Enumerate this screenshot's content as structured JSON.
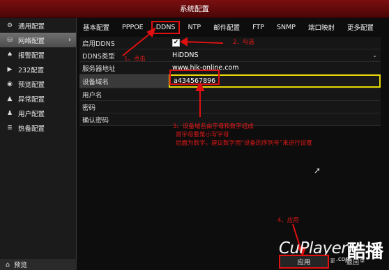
{
  "window": {
    "title": "系统配置"
  },
  "sidebar": {
    "items": [
      {
        "label": "通用配置",
        "icon": "gear-icon",
        "glyph": "⚙"
      },
      {
        "label": "网络配置",
        "icon": "network-icon",
        "glyph": "⛁",
        "active": true
      },
      {
        "label": "报警配置",
        "icon": "bell-icon",
        "glyph": "♠"
      },
      {
        "label": "232配置",
        "icon": "port-icon",
        "glyph": "▶"
      },
      {
        "label": "预览配置",
        "icon": "eye-icon",
        "glyph": "◉"
      },
      {
        "label": "异常配置",
        "icon": "warning-icon",
        "glyph": "▲"
      },
      {
        "label": "用户配置",
        "icon": "users-icon",
        "glyph": "♟"
      },
      {
        "label": "热备配置",
        "icon": "server-icon",
        "glyph": "≣"
      }
    ],
    "bottom_label": "预览",
    "bottom_icon_glyph": "⌂"
  },
  "tabs": [
    "基本配置",
    "PPPOE",
    "DDNS",
    "NTP",
    "邮件配置",
    "FTP",
    "SNMP",
    "端口映射",
    "更多配置"
  ],
  "active_tab": "DDNS",
  "form": {
    "enable_label": "启用DDNS",
    "enable_checked": "✔",
    "type_label": "DDNS类型",
    "type_value": "HiDDNS",
    "server_label": "服务器地址",
    "server_value": "www.hik-online.com",
    "domain_label": "设备域名",
    "domain_value": "a434567896",
    "user_label": "用户名",
    "user_value": "",
    "password_label": "密码",
    "password_value": "",
    "confirm_label": "确认密码",
    "confirm_value": ""
  },
  "annotations": {
    "step1": "1、点击",
    "step2": "2、勾选",
    "step3_line1": "3、设备域名由字母和数字组成",
    "step3_line2": "首字母要是小写字母",
    "step3_line3": "后面为数字，建议数字用“设备的序列号”来进行设置",
    "step4": "4、应用"
  },
  "footer": {
    "apply_label": "应用",
    "back_label": "返回"
  },
  "watermark": {
    "brand": "CuPlayer",
    "brand_cn": "酷播",
    "sub": "让 视 频 更 简 单",
    "dotcom": ".com"
  },
  "colors": {
    "title_red": "#7a0f10",
    "annotation_red": "#e01818",
    "highlight_yellow": "#e6d800"
  }
}
